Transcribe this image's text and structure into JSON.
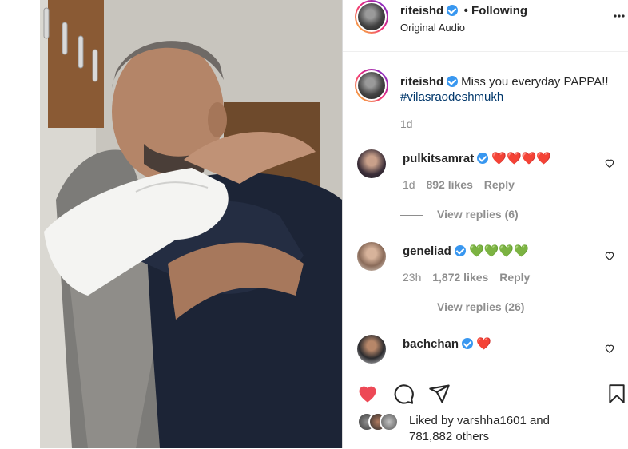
{
  "post": {
    "author": "riteishd",
    "follow_status": "• Following",
    "audio": "Original Audio"
  },
  "caption": {
    "username": "riteishd",
    "text": "Miss you everyday PAPPA!!",
    "hashtag": "#vilasraodeshmukh",
    "age": "1d"
  },
  "comments": [
    {
      "username": "pulkitsamrat",
      "emojis": "❤️❤️❤️❤️",
      "age": "1d",
      "likes": "892 likes",
      "reply": "Reply",
      "view_replies": "View replies (6)"
    },
    {
      "username": "geneliad",
      "emojis": "💚💚💚💚",
      "age": "23h",
      "likes": "1,872 likes",
      "reply": "Reply",
      "view_replies": "View replies (26)"
    },
    {
      "username": "bachchan",
      "emojis": "❤️"
    }
  ],
  "likes": {
    "liked_by_prefix": "Liked by",
    "liked_by_user": "varshha1601",
    "and_text": "and",
    "others": "781,882 others"
  },
  "icons": {
    "more": "more-options-icon",
    "like": "heart-filled-icon",
    "comment": "comment-icon",
    "share": "share-icon",
    "save": "bookmark-icon"
  },
  "colors": {
    "like_red": "#ed4956",
    "verified_blue": "#3897f0",
    "hashtag": "#00376b"
  }
}
